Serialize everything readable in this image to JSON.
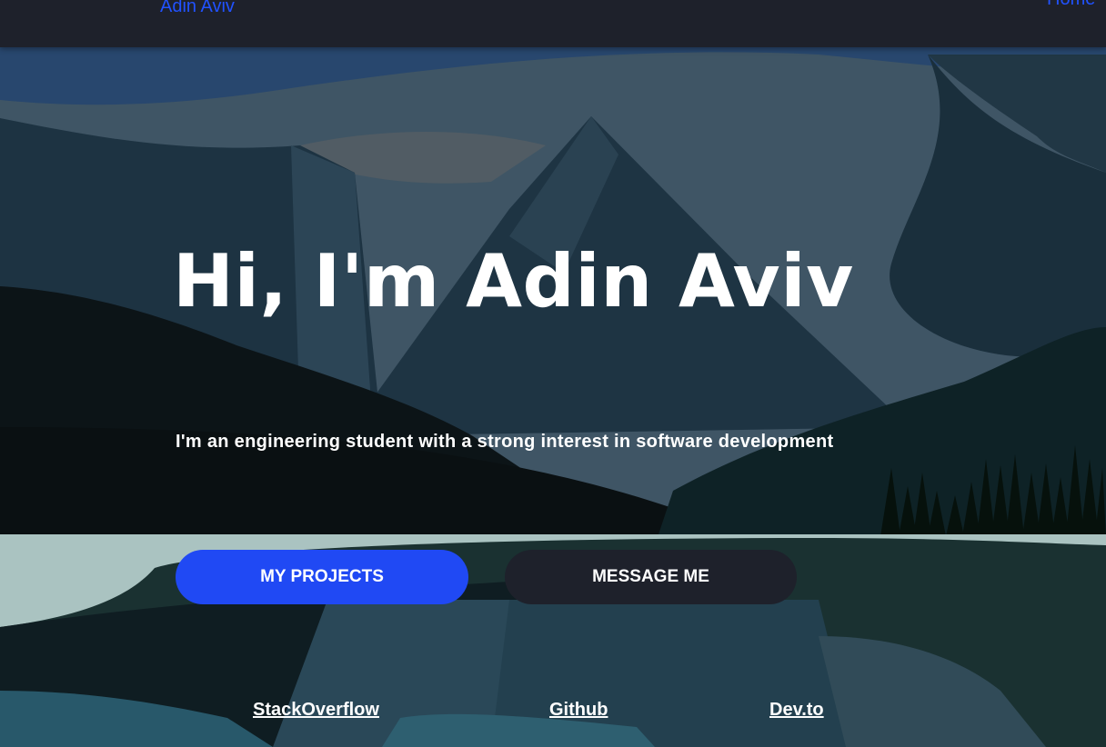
{
  "navbar": {
    "brand": "Adin Aviv",
    "home_link": "Home"
  },
  "hero": {
    "title": "Hi, I'm Adin Aviv",
    "subtitle": "I'm an engineering student with a strong interest in software development"
  },
  "buttons": {
    "projects_label": "MY PROJECTS",
    "message_label": "MESSAGE ME"
  },
  "social_links": [
    {
      "label": "StackOverflow"
    },
    {
      "label": "Github"
    },
    {
      "label": "Dev.to"
    }
  ],
  "colors": {
    "accent": "#2152ff",
    "navbar_bg": "#1e212b",
    "text": "#ffffff"
  }
}
